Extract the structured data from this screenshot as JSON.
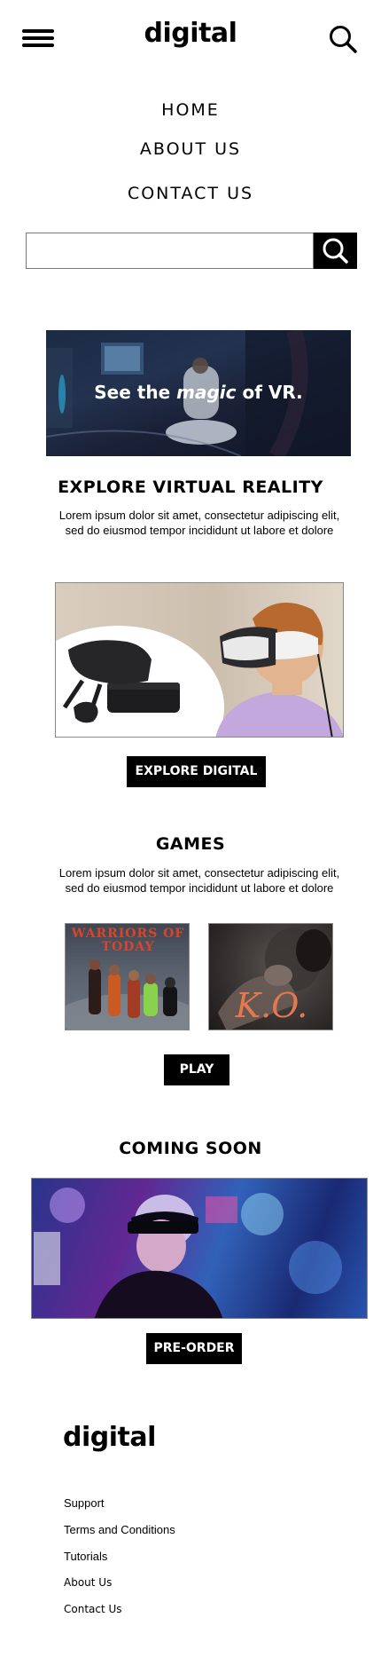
{
  "header": {
    "logo": "digital",
    "menu_icon": "hamburger-menu-icon",
    "search_icon": "search-icon"
  },
  "nav": {
    "items": [
      {
        "label": "HOME"
      },
      {
        "label": "ABOUT US"
      },
      {
        "label": "CONTACT US"
      }
    ]
  },
  "search": {
    "value": "",
    "placeholder": "",
    "button_icon": "search-icon"
  },
  "hero": {
    "text_before": "See the ",
    "text_emphasis": "magic",
    "text_after": " of VR."
  },
  "explore": {
    "title": "EXPLORE VIRTUAL REALITY",
    "description": "Lorem ipsum dolor sit amet, consectetur adipiscing elit, sed do eiusmod tempor incididunt ut labore et dolore",
    "button_label": "EXPLORE DIGITAL"
  },
  "games": {
    "title": "GAMES",
    "description": "Lorem ipsum dolor sit amet, consectetur adipiscing elit, sed do eiusmod tempor incididunt ut labore et dolore",
    "cards": [
      {
        "title": "WARRIORS OF TODAY"
      },
      {
        "title": "K.O."
      }
    ],
    "button_label": "PLAY"
  },
  "coming_soon": {
    "title": "COMING SOON",
    "button_label": "PRE-ORDER"
  },
  "footer": {
    "logo": "digital",
    "links": [
      {
        "label": "Support"
      },
      {
        "label": "Terms and Conditions"
      },
      {
        "label": "Tutorials"
      },
      {
        "label": "About Us"
      },
      {
        "label": "Contact Us"
      }
    ]
  },
  "colors": {
    "primary": "#000000",
    "background": "#ffffff",
    "button_text": "#ffffff"
  }
}
